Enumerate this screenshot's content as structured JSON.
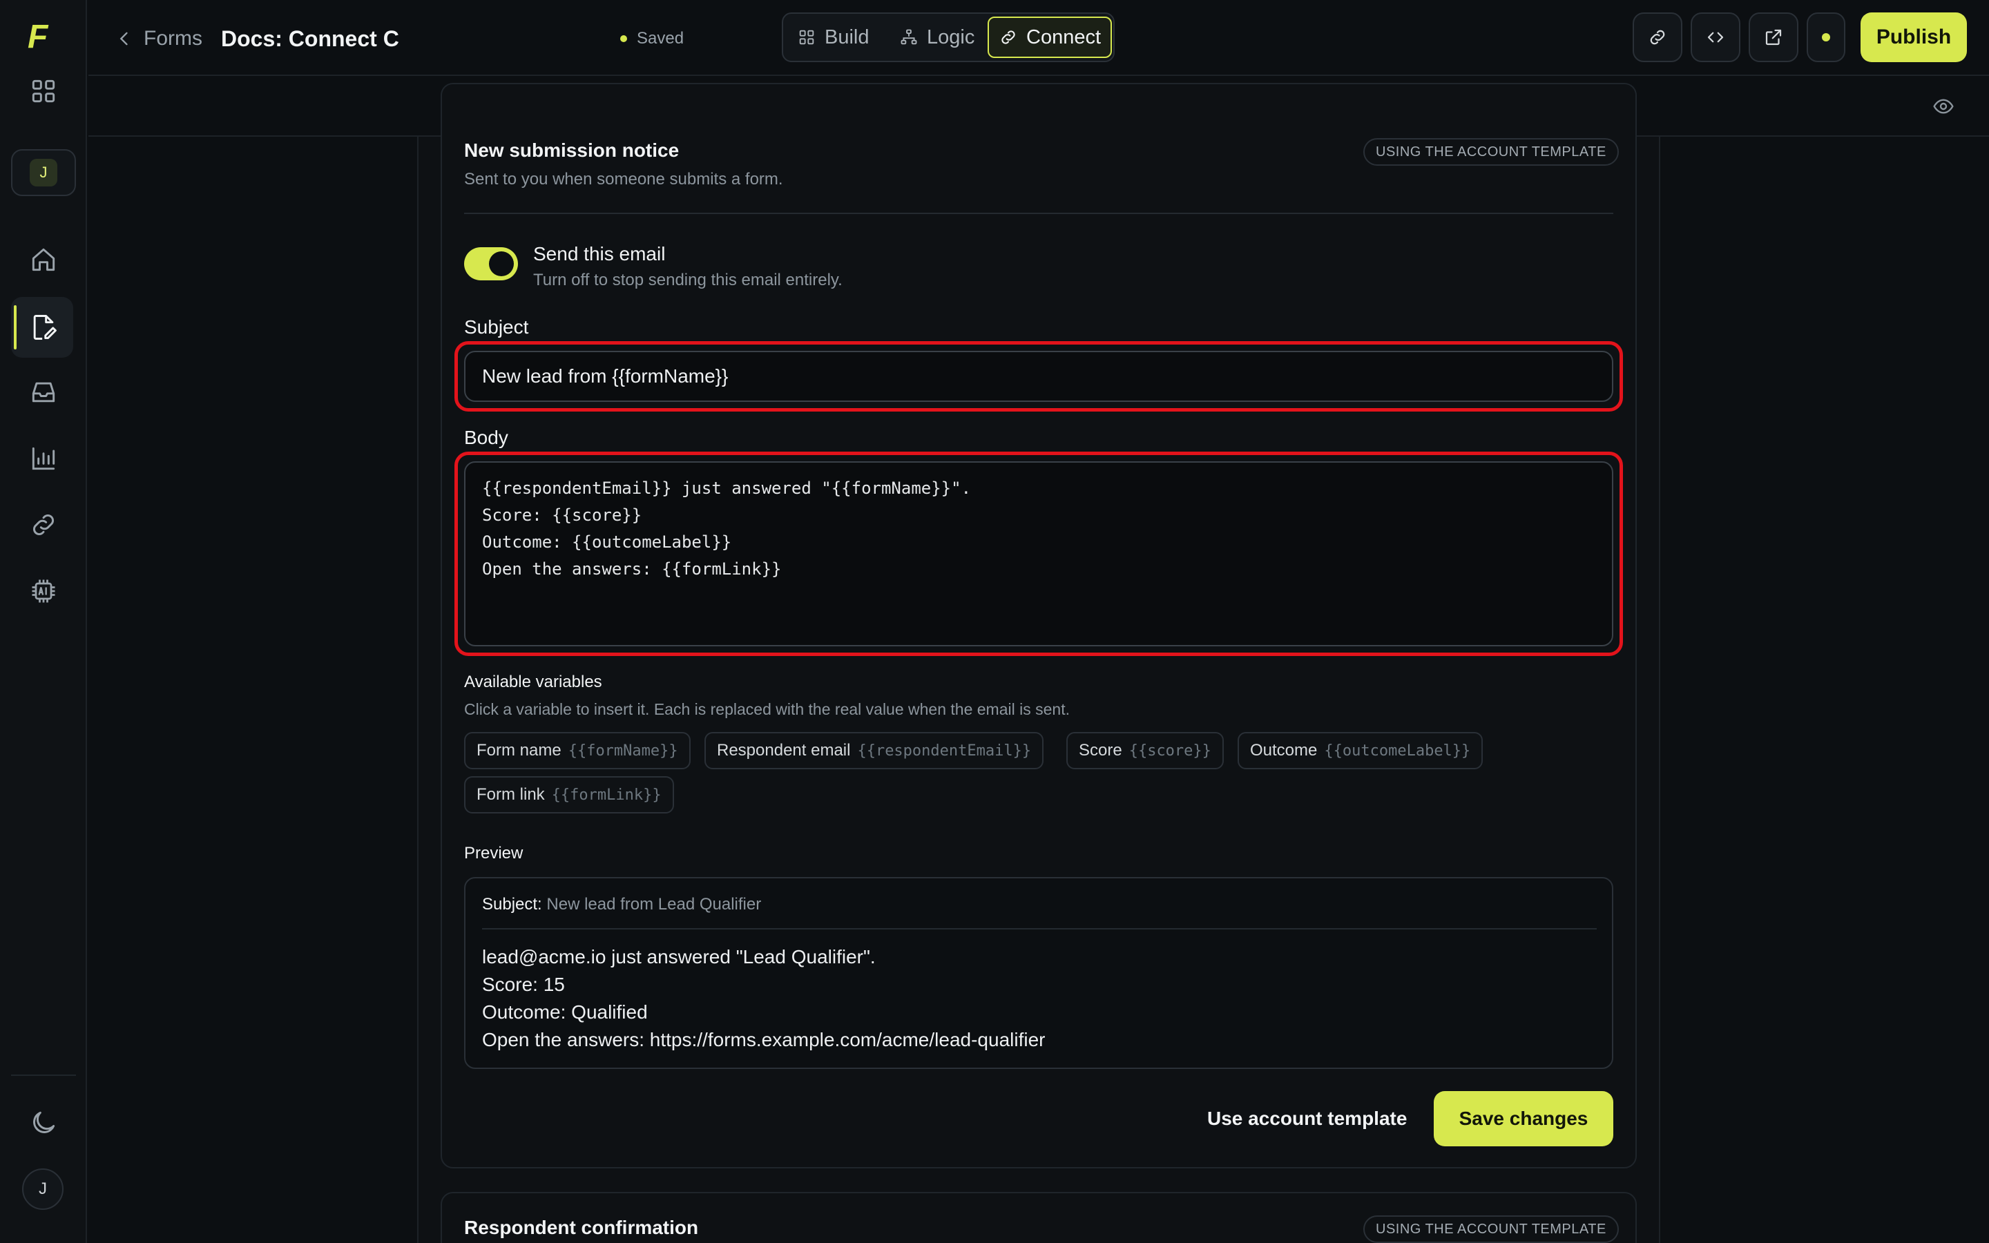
{
  "sidebar": {
    "logo": "F",
    "workspace_initial": "J",
    "user_initial": "J"
  },
  "header": {
    "back_label": "Forms",
    "title": "Docs: Connect C",
    "status": "Saved",
    "tabs": [
      {
        "label": "Build"
      },
      {
        "label": "Logic"
      },
      {
        "label": "Connect"
      }
    ],
    "publish_label": "Publish"
  },
  "notice": {
    "title": "New submission notice",
    "description": "Sent to you when someone submits a form.",
    "badge": "USING THE ACCOUNT TEMPLATE",
    "toggle_title": "Send this email",
    "toggle_description": "Turn off to stop sending this email entirely.",
    "toggle_on": true,
    "subject_label": "Subject",
    "subject_value": "New lead from {{formName}}",
    "body_label": "Body",
    "body_value": "{{respondentEmail}} just answered \"{{formName}}\".\nScore: {{score}}\nOutcome: {{outcomeLabel}}\nOpen the answers: {{formLink}}",
    "variables_title": "Available variables",
    "variables_description": "Click a variable to insert it. Each is replaced with the real value when the email is sent.",
    "variables": [
      {
        "label": "Form name",
        "token": "{{formName}}"
      },
      {
        "label": "Respondent email",
        "token": "{{respondentEmail}}"
      },
      {
        "label": "Score",
        "token": "{{score}}"
      },
      {
        "label": "Outcome",
        "token": "{{outcomeLabel}}"
      },
      {
        "label": "Form link",
        "token": "{{formLink}}"
      }
    ],
    "preview_label": "Preview",
    "preview_subject_label": "Subject:",
    "preview_subject_value": "New lead from Lead Qualifier",
    "preview_lines": [
      "lead@acme.io just answered \"Lead Qualifier\".",
      "Score: 15",
      "Outcome: Qualified",
      "Open the answers: https://forms.example.com/acme/lead-qualifier"
    ],
    "use_template_label": "Use account template",
    "save_label": "Save changes"
  },
  "confirmation": {
    "title": "Respondent confirmation",
    "badge": "USING THE ACCOUNT TEMPLATE"
  },
  "colors": {
    "accent": "#d7e84e",
    "highlight": "#e3131b",
    "background": "#0c0f12"
  }
}
